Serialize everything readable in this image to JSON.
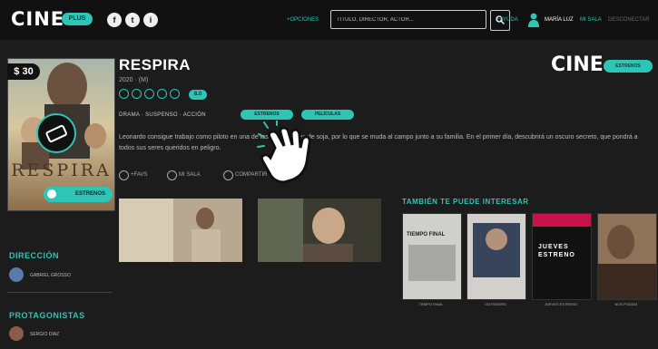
{
  "header": {
    "logo_text": "CINE",
    "logo_badge": "PLUS",
    "social": [
      "f",
      "t",
      "i"
    ],
    "nav_left": "+OPCIONES",
    "search": {
      "placeholder": "TÍTULO, DIRECTOR, ACTOR..."
    },
    "search_icon": "search-icon",
    "nav_help": "+AYUDA",
    "user_name": "MARÍA LUZ",
    "user_link": "MI SALA",
    "logout": "DESCONECTAR"
  },
  "poster": {
    "price": "$ 30",
    "title": "RESPIRA",
    "badge": "ESTRENOS"
  },
  "film": {
    "title": "RESPIRA",
    "meta": "2020 · (M)",
    "rating": "8.0",
    "genres": "DRAMA · SUSPENSO · ACCIÓN",
    "pill_1": "ESTRENOS",
    "pill_2": "PELÍCULAS",
    "synopsis": "Leonardo consigue trabajo como piloto en una de las plantaciones de soja, por lo que se muda al campo junto a su familia. En el primer día, descubrirá un oscuro secreto, que pondrá a todos sus seres queridos en peligro.",
    "action_1": "+FAVS",
    "action_2": "MI SALA",
    "action_3": "COMPARTIR"
  },
  "sidebar": {
    "direction_head": "DIRECCIÓN",
    "director": "GABRIEL GROSSO",
    "cast_head": "PROTAGONISTAS",
    "actor": "SERGIO DIAZ"
  },
  "brand_right": {
    "text": "CINE",
    "pill": "ESTRENOS"
  },
  "recommendations": {
    "head": "TAMBIÉN TE PUEDE INTERESAR",
    "items": [
      {
        "label": "TEMPO FINAL",
        "poster_text": "TIEMPO FINAL"
      },
      {
        "label": "OUTSIDERS",
        "poster_text": ""
      },
      {
        "label": "JUEVES ESTRENO",
        "poster_text": "JUEVES ESTRENO"
      },
      {
        "label": "NOS PODÍAS",
        "poster_text": ""
      }
    ]
  },
  "colors": {
    "accent": "#2ec4b6",
    "bg": "#1c1c1c",
    "topbar": "#111111"
  }
}
